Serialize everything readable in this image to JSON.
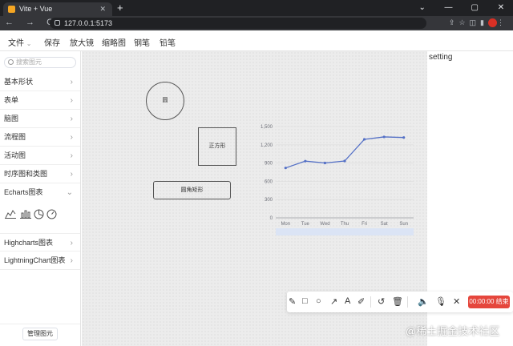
{
  "browser": {
    "tab_title": "Vite + Vue",
    "tab_close": "✕",
    "new_tab": "+",
    "url": "127.0.0.1:5173",
    "nav": "← → C",
    "window_controls": [
      "⌄",
      "—",
      "▢",
      "✕"
    ]
  },
  "toolbar": {
    "file_label": "文件",
    "save_label": "保存",
    "magnifier_label": "放大镜",
    "thumbnail_label": "缩略图",
    "pen_label": "钢笔",
    "brush_label": "铅笔"
  },
  "sidebar": {
    "search_placeholder": "搜索图元",
    "categories": [
      {
        "label": "基本形状"
      },
      {
        "label": "表单"
      },
      {
        "label": "脑图"
      },
      {
        "label": "流程图"
      },
      {
        "label": "活动图"
      },
      {
        "label": "时序图和类图"
      },
      {
        "label": "Echarts图表"
      },
      {
        "label": "Highcharts图表"
      },
      {
        "label": "LightningChart图表"
      }
    ],
    "manage_button": "管理图元"
  },
  "canvas": {
    "circle_label": "圆",
    "square_label": "正方形",
    "rounded_rect_label": "圆角矩形"
  },
  "chart_data": {
    "type": "line",
    "categories": [
      "Mon",
      "Tue",
      "Wed",
      "Thu",
      "Fri",
      "Sat",
      "Sun"
    ],
    "values": [
      820,
      932,
      901,
      934,
      1290,
      1330,
      1320
    ],
    "y_ticks": [
      "0",
      "300",
      "600",
      "900",
      "1,200",
      "1,500"
    ],
    "ylim": [
      0,
      1500
    ],
    "grid": true,
    "color": "#5470c6"
  },
  "setting_panel": {
    "title": "setting"
  },
  "recorder": {
    "timer_label": "00:00:00 结束"
  },
  "watermark": "@稀土掘金技术社区"
}
